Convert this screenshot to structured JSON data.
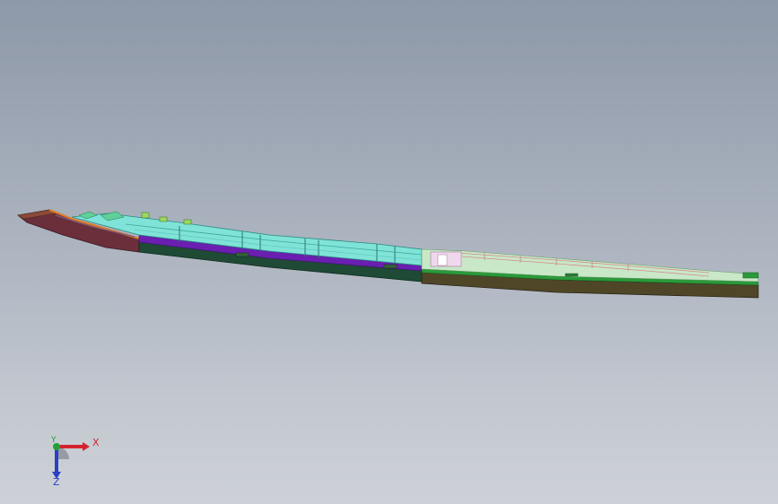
{
  "viewport": {
    "model": "sheet-metal-assembly",
    "background_top": "#8d98a8",
    "background_bottom": "#cdd1d7"
  },
  "triad": {
    "x_label": "X",
    "y_label": "Y",
    "z_label": "Z",
    "x_color": "#d4232c",
    "y_color": "#22a03a",
    "z_color": "#2a3fc2"
  }
}
